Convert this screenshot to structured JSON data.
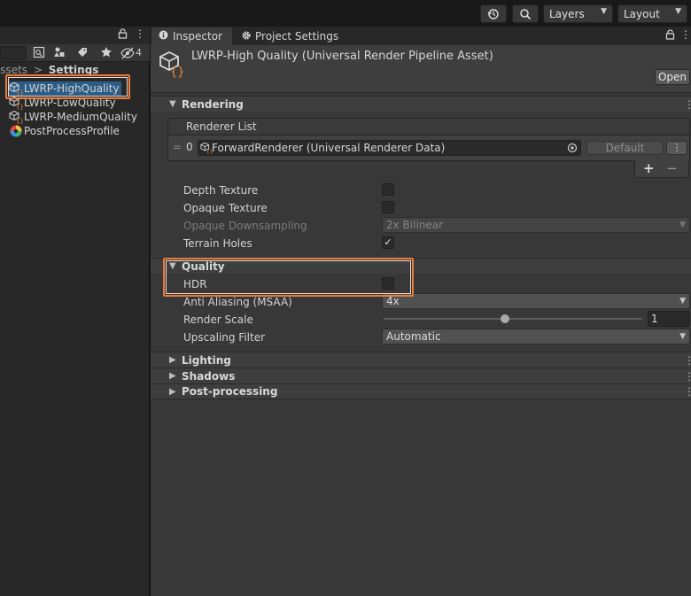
{
  "toolbar": {
    "history_icon": "history-icon",
    "search_icon": "search-icon",
    "layers_label": "Layers",
    "layout_label": "Layout"
  },
  "project": {
    "tab_lock_icon": "lock-icon",
    "tab_menu_icon": "kebab-menu-icon",
    "hidden_count": "4",
    "breadcrumb": {
      "root": "Assets",
      "separator": ">",
      "current": "Settings"
    },
    "assets": [
      {
        "name": "LWRP-HighQuality",
        "icon": "pipeline-asset-icon",
        "selected": true
      },
      {
        "name": "LWRP-LowQuality",
        "icon": "pipeline-asset-icon",
        "selected": false
      },
      {
        "name": "LWRP-MediumQuality",
        "icon": "pipeline-asset-icon",
        "selected": false
      },
      {
        "name": "PostProcessProfile",
        "icon": "post-process-profile-icon",
        "selected": false
      }
    ]
  },
  "inspector": {
    "tabs": [
      {
        "label": "Inspector",
        "icon": "info-icon",
        "active": true
      },
      {
        "label": "Project Settings",
        "icon": "gear-icon",
        "active": false
      }
    ],
    "asset_title": "LWRP-High Quality (Universal Render Pipeline Asset)",
    "open_label": "Open",
    "rendering": {
      "title": "Rendering",
      "renderer_list_label": "Renderer List",
      "renderer_index": "0",
      "renderer_value": "ForwardRenderer (Universal Renderer Data)",
      "default_label": "Default",
      "add_label": "+",
      "remove_label": "−",
      "depth_texture_label": "Depth Texture",
      "depth_texture_checked": false,
      "opaque_texture_label": "Opaque Texture",
      "opaque_texture_checked": false,
      "opaque_downsampling_label": "Opaque Downsampling",
      "opaque_downsampling_value": "2x Bilinear",
      "terrain_holes_label": "Terrain Holes",
      "terrain_holes_checked": true
    },
    "quality": {
      "title": "Quality",
      "hdr_label": "HDR",
      "hdr_checked": false,
      "msaa_label": "Anti Aliasing (MSAA)",
      "msaa_value": "4x",
      "render_scale_label": "Render Scale",
      "render_scale_value": "1",
      "render_scale_fraction": 0.47,
      "upscaling_label": "Upscaling Filter",
      "upscaling_value": "Automatic"
    },
    "collapsed_sections": [
      "Lighting",
      "Shadows",
      "Post-processing"
    ]
  },
  "colors": {
    "highlight": "#e87c3e",
    "selection": "#2c5d87"
  }
}
